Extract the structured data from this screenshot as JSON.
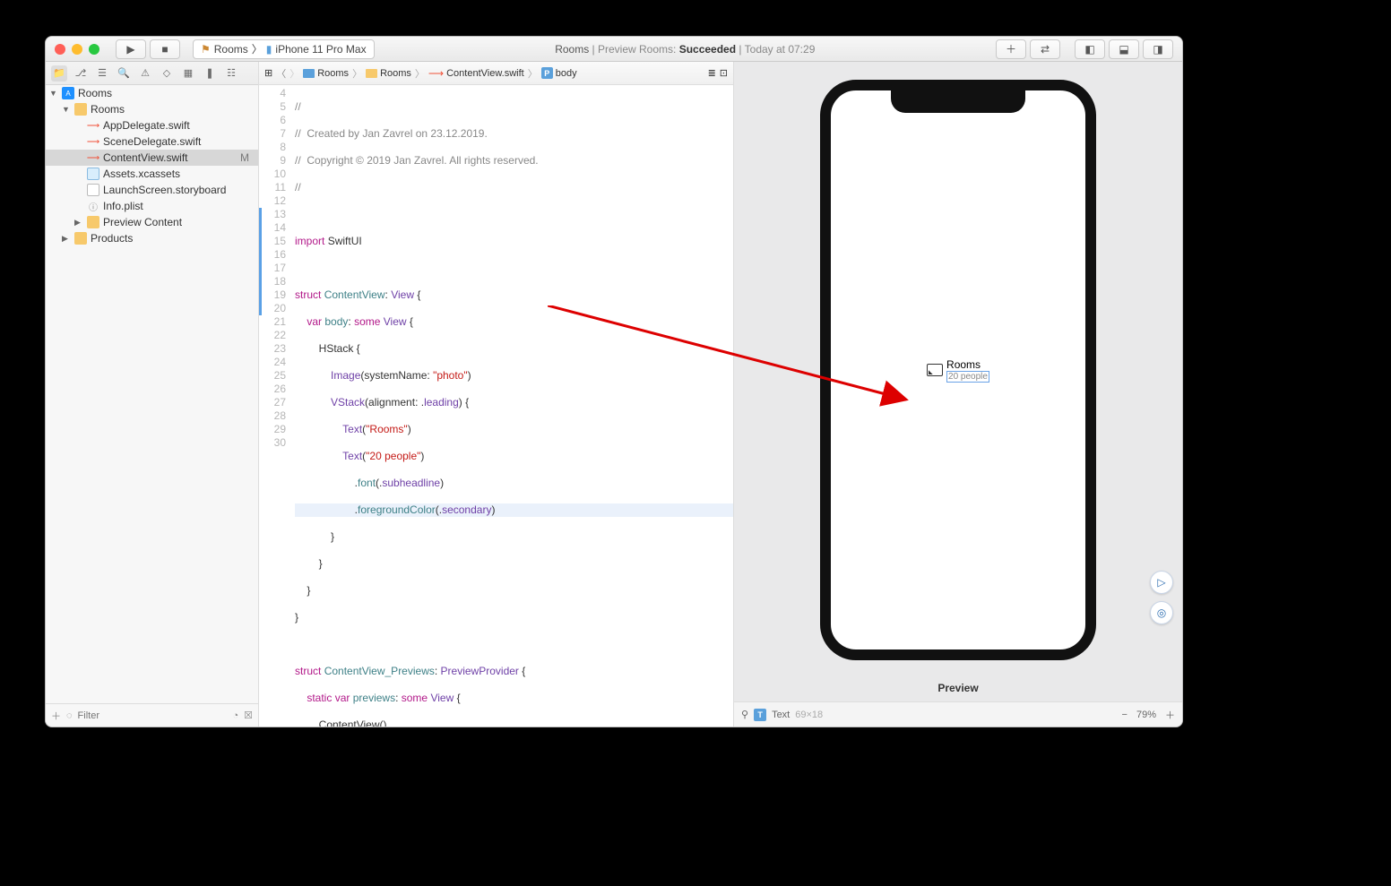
{
  "title": {
    "project": "Rooms",
    "action_prefix": " | Preview Rooms: ",
    "status": "Succeeded",
    "sep": " | ",
    "time": "Today at 07:29"
  },
  "scheme": {
    "project": "Rooms",
    "device": "iPhone 11 Pro Max"
  },
  "navigator": {
    "root": "Rooms",
    "group": "Rooms",
    "files": {
      "appdelegate": "AppDelegate.swift",
      "scenedelegate": "SceneDelegate.swift",
      "contentview": "ContentView.swift",
      "contentview_badge": "M",
      "assets": "Assets.xcassets",
      "launch": "LaunchScreen.storyboard",
      "info": "Info.plist"
    },
    "preview_content": "Preview Content",
    "products": "Products",
    "filter_placeholder": "Filter"
  },
  "jumpbar": {
    "root": "Rooms",
    "group": "Rooms",
    "file": "ContentView.swift",
    "symbol": "body"
  },
  "code": {
    "lines": {
      "4": "//",
      "5": "//  Created by Jan Zavrel on 23.12.2019.",
      "6": "//  Copyright © 2019 Jan Zavrel. All rights reserved.",
      "7": "//",
      "8": "",
      "13": "        HStack {",
      "20": "            }",
      "21": "        }",
      "22": "    }",
      "23": "}",
      "24": "",
      "27": "        ContentView()",
      "28": "    }",
      "29": "}",
      "30": ""
    },
    "tokens": {
      "import": "import",
      "swiftui": "SwiftUI",
      "struct": "struct",
      "contentview": "ContentView",
      "view": "View",
      "var": "var",
      "body": "body",
      "some": "some",
      "hstack": "HStack",
      "image": "Image",
      "systemname": "systemName",
      "photo": "\"photo\"",
      "vstack": "VStack",
      "alignment": "alignment",
      "leading": "leading",
      "text": "Text",
      "rooms": "\"Rooms\"",
      "people": "\"20 people\"",
      "font": "font",
      "subheadline": "subheadline",
      "foregroundcolor": "foregroundColor",
      "secondary": "secondary",
      "previews_struct": "ContentView_Previews",
      "previewprovider": "PreviewProvider",
      "static": "static",
      "previews": "previews"
    }
  },
  "preview": {
    "rooms": "Rooms",
    "people": "20 people",
    "label": "Preview",
    "footer_type": "Text",
    "footer_size": "69×18",
    "zoom": "79%"
  }
}
